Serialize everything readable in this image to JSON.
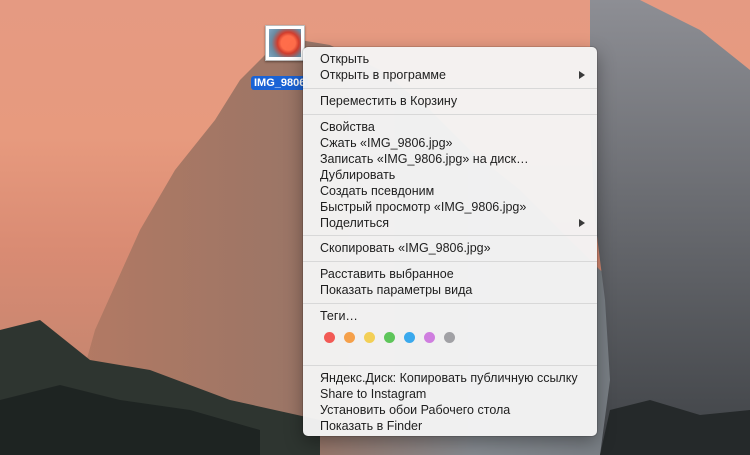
{
  "desktop": {
    "file_name": "IMG_9806.jpg",
    "file_label": "IMG_9806"
  },
  "menu": {
    "open": "Открыть",
    "open_with": "Открыть в программе",
    "move_to_trash": "Переместить в Корзину",
    "get_info": "Свойства",
    "compress": "Сжать «IMG_9806.jpg»",
    "burn": "Записать «IMG_9806.jpg» на диск…",
    "duplicate": "Дублировать",
    "make_alias": "Создать псевдоним",
    "quick_look": "Быстрый просмотр «IMG_9806.jpg»",
    "share": "Поделиться",
    "copy": "Скопировать «IMG_9806.jpg»",
    "arrange_selected": "Расставить выбранное",
    "show_view_options": "Показать параметры вида",
    "tags": "Теги…",
    "tag_colors": [
      {
        "name": "red",
        "color": "#f25a55"
      },
      {
        "name": "orange",
        "color": "#f5a04a"
      },
      {
        "name": "yellow",
        "color": "#f3cf56"
      },
      {
        "name": "green",
        "color": "#5ec55a"
      },
      {
        "name": "blue",
        "color": "#3aa9ed"
      },
      {
        "name": "purple",
        "color": "#cf7edf"
      },
      {
        "name": "gray",
        "color": "#a1a1a5"
      }
    ],
    "yandex_disk": "Яндекс.Диск: Копировать публичную ссылку",
    "share_instagram": "Share to Instagram",
    "set_desktop": "Установить обои Рабочего стола",
    "reveal_in_finder": "Показать в Finder"
  }
}
